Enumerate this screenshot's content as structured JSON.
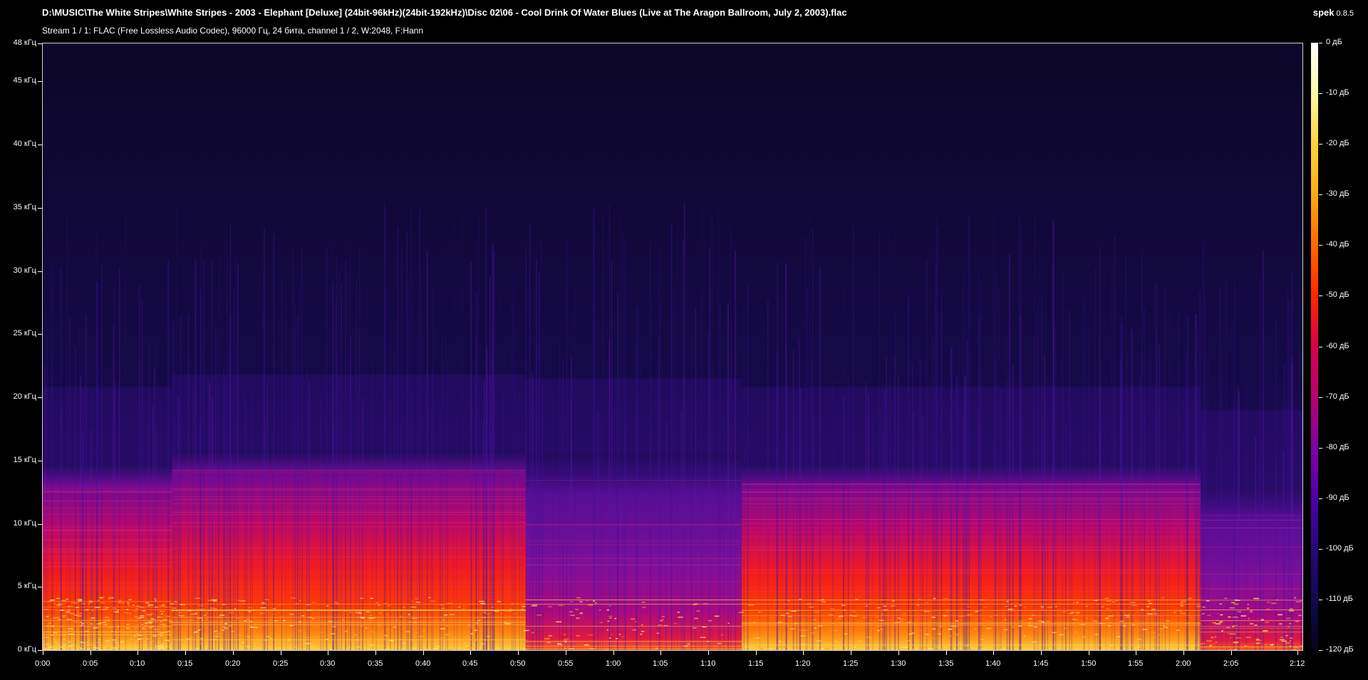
{
  "window": {
    "title": "D:\\MUSIC\\The White Stripes\\White Stripes - 2003 - Elephant [Deluxe] (24bit-96kHz)(24bit-192kHz)\\Disc 02\\06 - Cool Drink Of Water Blues (Live at The Aragon Ballroom, July 2, 2003).flac",
    "stream_info": "Stream 1 / 1: FLAC (Free Lossless Audio Codec), 96000 Гц, 24 бита, channel 1 / 2, W:2048, F:Hann",
    "app_name": "spek",
    "app_version": "0.8.5"
  },
  "axes": {
    "freq_ticks": [
      "48 кГц",
      "45 кГц",
      "40 кГц",
      "35 кГц",
      "30 кГц",
      "25 кГц",
      "20 кГц",
      "15 кГц",
      "10 кГц",
      "5 кГц",
      "0 кГц"
    ],
    "freq_values_khz": [
      48,
      45,
      40,
      35,
      30,
      25,
      20,
      15,
      10,
      5,
      0
    ],
    "time_ticks": [
      "0:00",
      "0:05",
      "0:10",
      "0:15",
      "0:20",
      "0:25",
      "0:30",
      "0:35",
      "0:40",
      "0:45",
      "0:50",
      "0:55",
      "1:00",
      "1:05",
      "1:10",
      "1:15",
      "1:20",
      "1:25",
      "1:30",
      "1:35",
      "1:40",
      "1:45",
      "1:50",
      "1:55",
      "2:00",
      "2:05",
      "2:12"
    ],
    "time_values_s": [
      0,
      5,
      10,
      15,
      20,
      25,
      30,
      35,
      40,
      45,
      50,
      55,
      60,
      65,
      70,
      75,
      80,
      85,
      90,
      95,
      100,
      105,
      110,
      115,
      120,
      125,
      132
    ],
    "time_max_s": 132.5,
    "freq_max_khz": 48
  },
  "colorbar": {
    "labels": [
      "0 дБ",
      "-10 дБ",
      "-20 дБ",
      "-30 дБ",
      "-40 дБ",
      "-50 дБ",
      "-60 дБ",
      "-70 дБ",
      "-80 дБ",
      "-90 дБ",
      "-100 дБ",
      "-110 дБ",
      "-120 дБ"
    ],
    "values_db": [
      0,
      -10,
      -20,
      -30,
      -40,
      -50,
      -60,
      -70,
      -80,
      -90,
      -100,
      -110,
      -120
    ]
  },
  "segments": [
    {
      "start_s": 0,
      "end_s": 13.6,
      "top_khz": 12.8,
      "level": 0.82
    },
    {
      "start_s": 13.6,
      "end_s": 50.8,
      "top_khz": 13.8,
      "level": 0.95
    },
    {
      "start_s": 50.8,
      "end_s": 73.5,
      "top_khz": 13.5,
      "level": 0.55
    },
    {
      "start_s": 73.5,
      "end_s": 121.8,
      "top_khz": 12.8,
      "level": 0.98
    },
    {
      "start_s": 121.8,
      "end_s": 132.5,
      "top_khz": 11.0,
      "level": 0.6
    }
  ],
  "colors": {
    "background": "#000000",
    "spectrum_floor": "#0e0830",
    "axis": "#ffffff",
    "border": "#cfcfcf"
  }
}
